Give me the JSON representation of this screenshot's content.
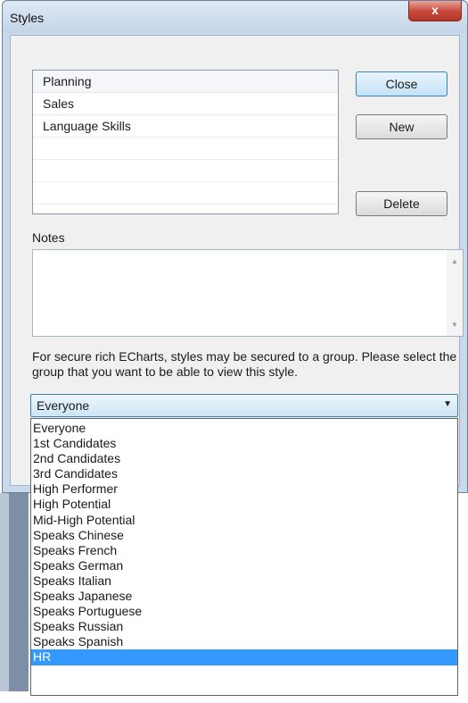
{
  "window": {
    "title": "Styles",
    "close_glyph": "x"
  },
  "styles_list": [
    "Planning",
    "Sales",
    "Language Skills",
    "",
    "",
    ""
  ],
  "buttons": {
    "close": "Close",
    "new": "New",
    "delete": "Delete"
  },
  "notes": {
    "label": "Notes",
    "value": ""
  },
  "info_text": "For secure rich ECharts, styles may be secured to a group. Please select the group that you want to be able to view this style.",
  "group_select": {
    "value": "Everyone",
    "options": [
      "Everyone",
      "1st Candidates",
      "2nd Candidates",
      "3rd Candidates",
      "High Performer",
      "High Potential",
      "Mid-High Potential",
      "Speaks Chinese",
      "Speaks French",
      "Speaks German",
      "Speaks Italian",
      "Speaks Japanese",
      "Speaks Portuguese",
      "Speaks Russian",
      "Speaks Spanish",
      "HR"
    ],
    "highlighted": "HR"
  },
  "icons": {
    "close": "close-icon",
    "dropdown": "chevron-down-icon",
    "scroll_up": "scroll-up-icon",
    "scroll_down": "scroll-down-icon"
  },
  "colors": {
    "highlight": "#3399ff",
    "close_button": "#c8473b",
    "combo_border": "#3c7fb1"
  }
}
